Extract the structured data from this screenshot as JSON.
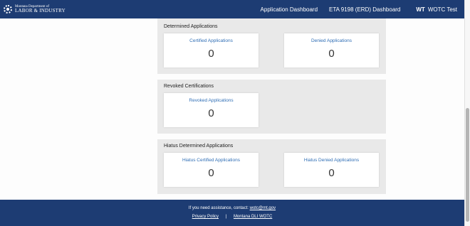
{
  "header": {
    "logo_line1": "Montana Department of",
    "logo_line2": "LABOR & INDUSTRY",
    "nav": [
      "Application Dashboard",
      "ETA 9198 (ERD) Dashboard"
    ],
    "user_initials": "WT",
    "user_name": "WOTC Test"
  },
  "sections": [
    {
      "title": "Determined Applications",
      "cards": [
        {
          "label": "Certified Applications",
          "value": "0"
        },
        {
          "label": "Denied Applications",
          "value": "0"
        }
      ]
    },
    {
      "title": "Revoked Certifications",
      "cards": [
        {
          "label": "Revoked Applications",
          "value": "0"
        }
      ]
    },
    {
      "title": "Hiatus Determined Applications",
      "cards": [
        {
          "label": "Hiatus Certified Applications",
          "value": "0"
        },
        {
          "label": "Hiatus Denied Applications",
          "value": "0"
        }
      ]
    }
  ],
  "footer": {
    "assist_text": "If you need assistance, contact:",
    "assist_email": "wotc@mt.gov",
    "separator": "|",
    "links": [
      "Privacy Policy",
      "Montana DLI WOTC"
    ]
  },
  "colors": {
    "header_bg": "#1d3c73",
    "link": "#2f6eb5",
    "section_bg": "#e9e9e9"
  }
}
